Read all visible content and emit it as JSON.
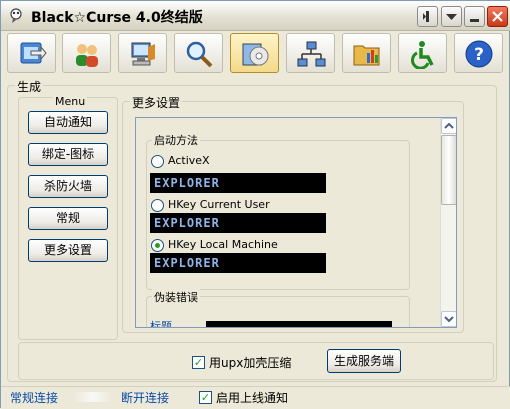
{
  "window": {
    "title": "Black☆Curse 4.0终结版"
  },
  "toolbar": {
    "items": [
      {
        "icon": "screen-arrow-icon"
      },
      {
        "icon": "users-icon"
      },
      {
        "icon": "computer-icon"
      },
      {
        "icon": "magnifier-icon"
      },
      {
        "icon": "disc-icon",
        "active": true
      },
      {
        "icon": "network-icon"
      },
      {
        "icon": "folder-chart-icon"
      },
      {
        "icon": "accessibility-icon"
      },
      {
        "icon": "help-icon"
      }
    ]
  },
  "generate": {
    "group_label": "生成",
    "menu_label": "Menu",
    "menu_items": [
      "自动通知",
      "绑定-图标",
      "杀防火墙",
      "常规",
      "更多设置"
    ],
    "more_settings_label": "更多设置",
    "startup": {
      "label": "启动方法",
      "options": [
        {
          "label": "ActiveX",
          "value": "EXPLORER",
          "selected": false
        },
        {
          "label": "HKey Current User",
          "value": "EXPLORER",
          "selected": false
        },
        {
          "label": "HKey Local Machine",
          "value": "EXPLORER",
          "selected": true
        }
      ]
    },
    "fake_error": {
      "label": "伪装错误",
      "title_label": "标题"
    },
    "upx_label": "用upx加壳压缩",
    "upx_checked": true,
    "build_button": "生成服务端"
  },
  "status": {
    "normal": "常规连接",
    "disconnect": "断开连接",
    "notify_label": "启用上线通知",
    "notify_checked": true
  }
}
